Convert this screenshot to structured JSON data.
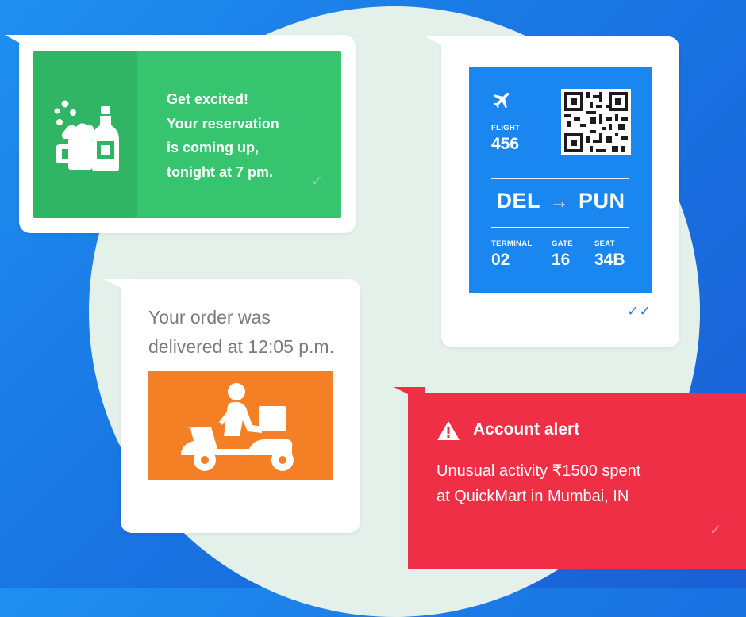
{
  "reservation": {
    "lines": [
      "Get excited!",
      "Your reservation",
      "is coming up,",
      "tonight at 7 pm."
    ],
    "status": "✓",
    "icon": "beer-and-bottle-icon",
    "color": "#37c46f"
  },
  "flight": {
    "flight_label": "FLIGHT",
    "flight_number": "456",
    "route_from": "DEL",
    "route_arrow": "→",
    "route_to": "PUN",
    "terminal_label": "TERMINAL",
    "terminal": "02",
    "gate_label": "GATE",
    "gate": "16",
    "seat_label": "SEAT",
    "seat": "34B",
    "status": "✓✓",
    "icon": "airplane-icon",
    "color": "#1a86f0"
  },
  "delivery": {
    "lines": [
      "Your order was",
      "delivered at 12:05 p.m."
    ],
    "icon": "delivery-scooter-icon",
    "color": "#f57f25"
  },
  "alert": {
    "title": "Account alert",
    "body_line1": "Unusual activity  ₹1500 spent",
    "body_line2": "at QuickMart in Mumbai, IN",
    "status": "✓",
    "icon": "warning-icon",
    "color": "#ef2f45"
  }
}
